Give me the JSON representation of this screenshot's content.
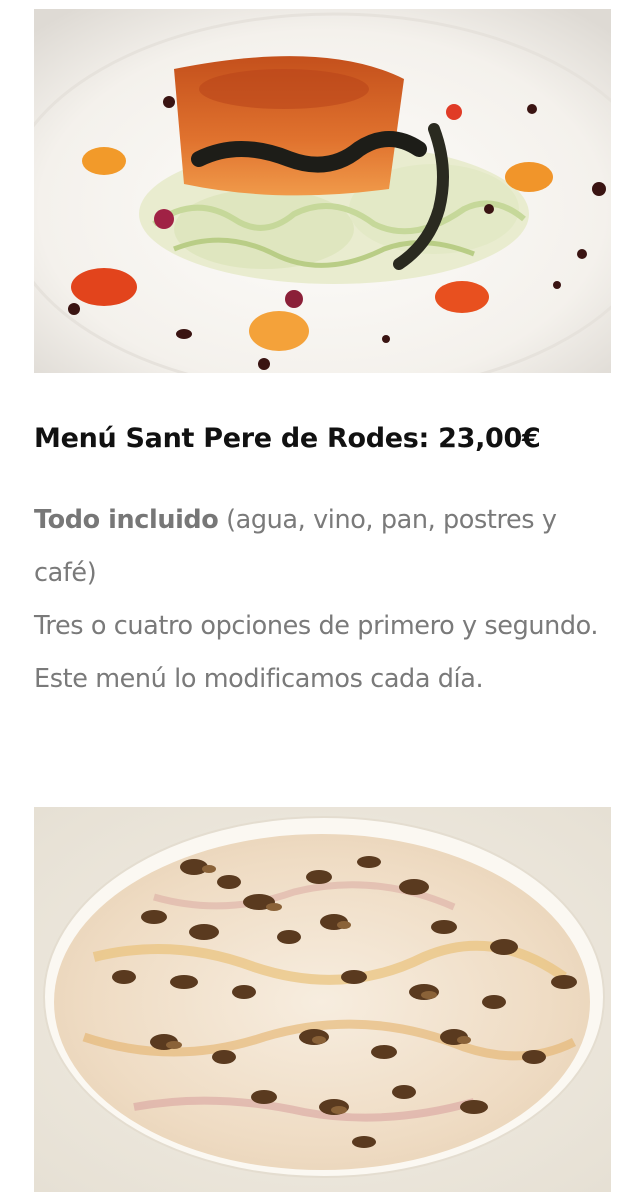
{
  "images": {
    "dish_top": {
      "icon": "food-photo-goat-cheese-salad"
    },
    "dish_bottom": {
      "icon": "food-photo-carpaccio-mushrooms"
    }
  },
  "menu": {
    "title": "Menú Sant Pere de Rodes: 23,00€",
    "included_bold": "Todo incluido",
    "included_rest": " (agua, vino, pan, postres y café)",
    "options_line": "Tres o cuatro opciones de primero y segundo.",
    "daily_line": "Este menú lo modificamos cada día."
  }
}
